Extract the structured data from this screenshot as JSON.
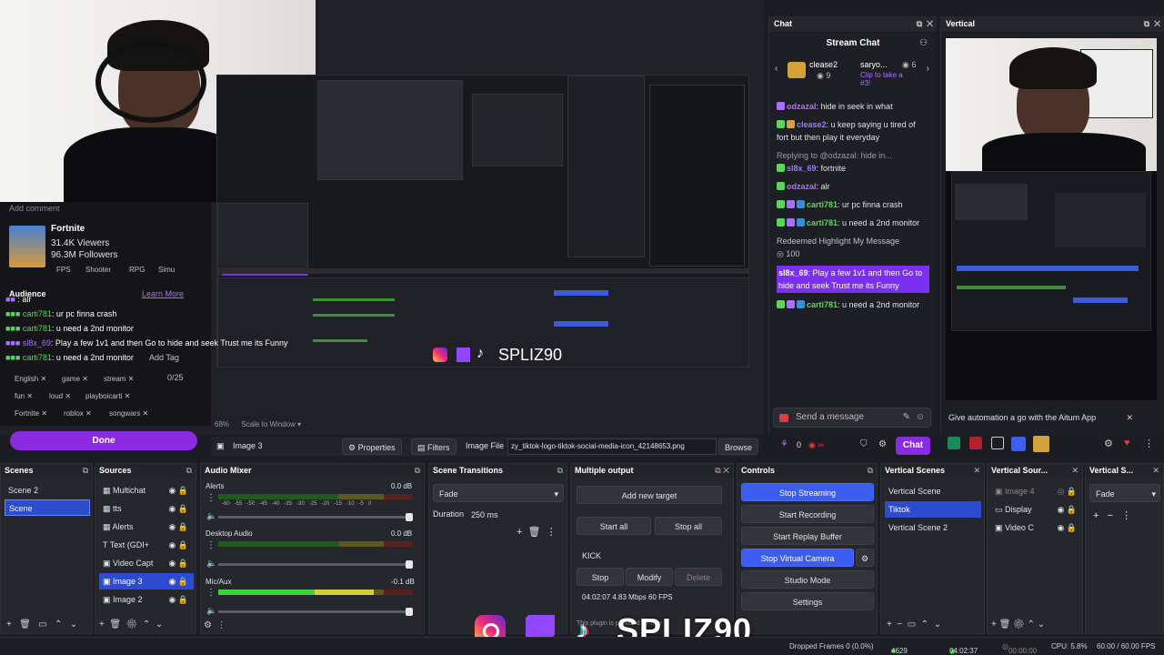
{
  "preview": {
    "nested_watermark": "SPLIZ90",
    "scale_info": "68%",
    "scale_mode": "Scale to Window"
  },
  "twitch_overlay": {
    "add_comment": "Add comment",
    "game": "Fortnite",
    "viewers": "31.4K Viewers",
    "followers": "96.3M Followers",
    "genres": [
      "FPS",
      "Shooter",
      "RPG",
      "Simu"
    ],
    "audience_label": "Audience",
    "learn_more": "Learn More",
    "add_tag": "Add Tag",
    "tag_count": "0/25",
    "chat_lines": [
      {
        "user": "",
        "text": ": alr"
      },
      {
        "user": "carti781",
        "text": ": ur pc finna crash"
      },
      {
        "user": "carti781",
        "text": ": u need a 2nd monitor"
      },
      {
        "user": "sl8x_69",
        "text": ": Play a few 1v1 and then Go to hide and seek Trust me its Funny"
      },
      {
        "user": "carti781",
        "text": ": u need a 2nd monitor"
      }
    ],
    "tags": [
      [
        "English",
        "game",
        "stream"
      ],
      [
        "fun",
        "loud",
        "playboicarti"
      ],
      [
        "Fortnite",
        "roblox",
        "songwars"
      ]
    ],
    "done": "Done"
  },
  "chat": {
    "dock_title": "Chat",
    "header": "Stream Chat",
    "pinned": [
      {
        "user": "clease2",
        "count": "9"
      },
      {
        "user": "saryo...",
        "count": "6",
        "note": "Clip to take a #3!"
      }
    ],
    "messages": [
      {
        "user": "odzazal",
        "color": "#b46cff",
        "text": ": hide in seek in what"
      },
      {
        "user": "clease2",
        "color": "#9a7bff",
        "text": ": u keep saying u tired of fort but then play it everyday"
      },
      {
        "reply": "Replying to @odzazal: hide in...",
        "user": "sl8x_69",
        "color": "#9a7bff",
        "text": ": fortnite"
      },
      {
        "user": "odzazal",
        "color": "#b46cff",
        "text": ": alr"
      },
      {
        "user": "carti781",
        "color": "#5fd35f",
        "text": ": ur pc finna crash"
      },
      {
        "user": "carti781",
        "color": "#5fd35f",
        "text": ": u need a 2nd monitor"
      }
    ],
    "redeem_title": "Redeemed Highlight My Message",
    "redeem_cost": "100",
    "highlight": {
      "user": "sl8x_69",
      "text": ": Play a few 1v1 and then Go to hide and seek Trust me its Funny"
    },
    "last": {
      "user": "carti781",
      "text": ": u need a 2nd monitor"
    },
    "input_placeholder": "Send a message",
    "points": "0",
    "chat_button": "Chat"
  },
  "vertical": {
    "dock_title": "Vertical",
    "notification": "Give automation a go with the Aitum App"
  },
  "source_bar": {
    "source_name": "Image 3",
    "properties": "Properties",
    "filters": "Filters",
    "image_file_label": "Image File",
    "image_path": "zy_tiktok-logo-tiktok-social-media-icon_42148653.png",
    "browse": "Browse"
  },
  "docks": {
    "scenes": {
      "title": "Scenes",
      "items": [
        "Scene 2",
        "Scene"
      ],
      "selected": 1
    },
    "sources": {
      "title": "Sources",
      "items": [
        "Multichat",
        "tts",
        "Alerts",
        "Text (GDI+",
        "Video Capt",
        "Image 3",
        "Image 2"
      ],
      "selected": 5
    },
    "audio": {
      "title": "Audio Mixer",
      "channels": [
        {
          "name": "Alerts",
          "db": "0.0 dB",
          "level": 0,
          "volume": 1.0
        },
        {
          "name": "Desktop Audio",
          "db": "0.0 dB",
          "level": 0,
          "volume": 1.0
        },
        {
          "name": "Mic/Aux",
          "db": "-0.1 dB",
          "level": 0.8,
          "volume": 1.0
        }
      ],
      "ticks": [
        "-60",
        "-55",
        "-50",
        "-45",
        "-40",
        "-35",
        "-30",
        "-25",
        "-20",
        "-15",
        "-10",
        "-5",
        "0"
      ]
    },
    "transitions": {
      "title": "Scene Transitions",
      "type": "Fade",
      "duration_label": "Duration",
      "duration": "250 ms"
    },
    "multi_output": {
      "title": "Multiple output",
      "add_target": "Add new target",
      "start_all": "Start all",
      "stop_all": "Stop all",
      "target": "KICK",
      "stop": "Stop",
      "modify": "Modify",
      "delete": "Delete",
      "stats": "04:02:07  4.83 Mbps  60 FPS",
      "plugin_note": "This plugin is provided for free"
    },
    "controls": {
      "title": "Controls",
      "stop_streaming": "Stop Streaming",
      "start_recording": "Start Recording",
      "start_replay": "Start Replay Buffer",
      "stop_virtual_cam": "Stop Virtual Camera",
      "studio_mode": "Studio Mode",
      "settings": "Settings"
    },
    "vertical_scenes": {
      "title": "Vertical Scenes",
      "items": [
        "Vertical Scene",
        "Tiktok",
        "Vertical Scene 2"
      ],
      "selected": 1
    },
    "vertical_sources": {
      "title": "Vertical Sour...",
      "items": [
        "Image 4",
        "Display",
        "Video C"
      ]
    },
    "vertical_s": {
      "title": "Vertical S...",
      "type": "Fade"
    }
  },
  "watermark": {
    "handle": "SPLIZ90"
  },
  "status": {
    "dropped": "Dropped Frames 0 (0.0%)",
    "bitrate": "4629 kbps",
    "live_time": "04:02:37",
    "rec_time": "00:00:00",
    "cpu": "CPU: 5.8%",
    "fps": "60.00 / 60.00 FPS"
  },
  "colors": {
    "accent_blue": "#3b5ef0",
    "twitch_purple": "#8a2be2",
    "highlight": "#7b2ff2"
  }
}
